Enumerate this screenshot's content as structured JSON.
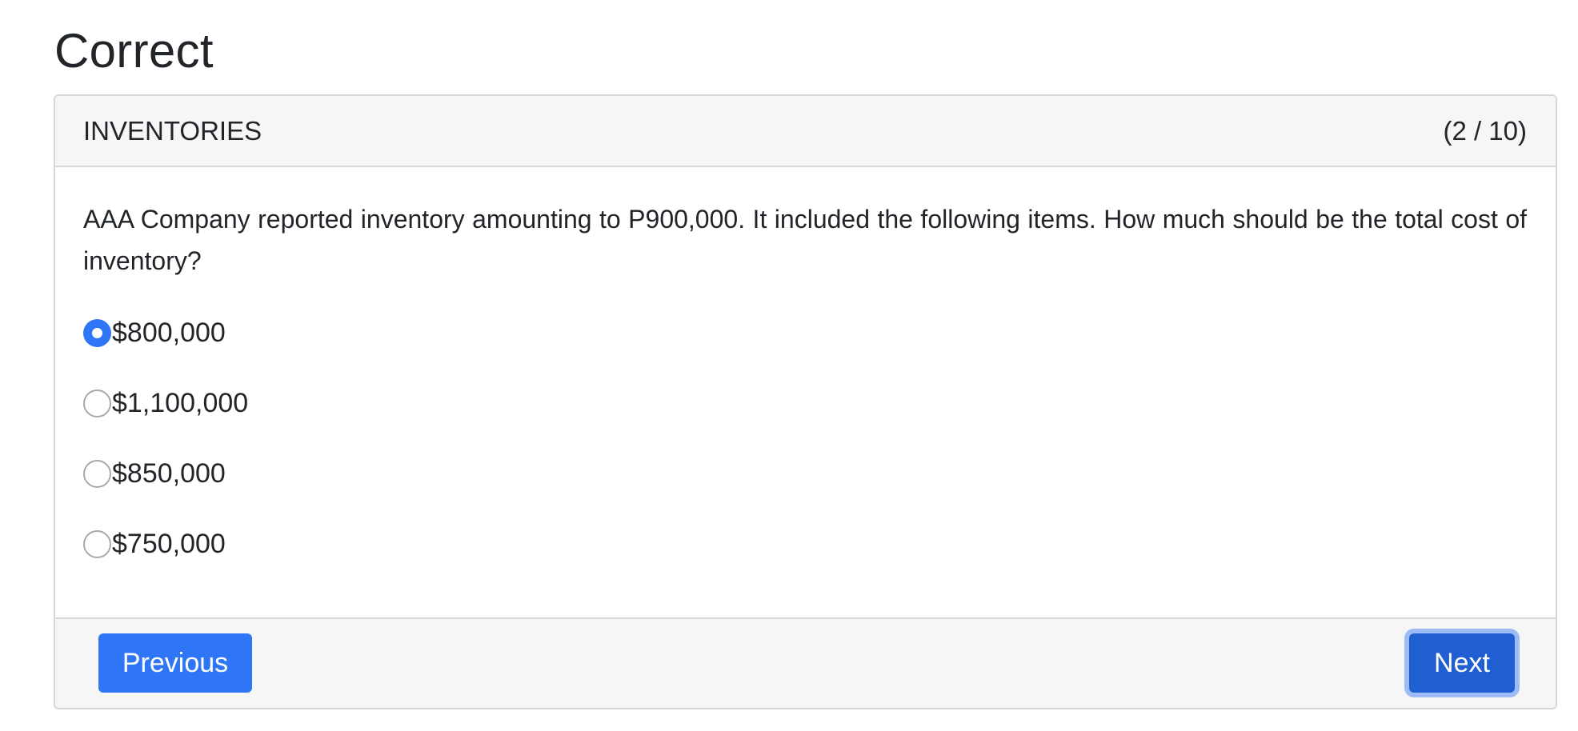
{
  "result": {
    "title": "Correct"
  },
  "quiz": {
    "category": "INVENTORIES",
    "progress": "(2 / 10)",
    "question": "AAA Company reported inventory amounting to P900,000. It included the following items. How much should be the total cost of inventory?",
    "options": [
      {
        "label": "$800,000",
        "selected": true
      },
      {
        "label": "$1,100,000",
        "selected": false
      },
      {
        "label": "$850,000",
        "selected": false
      },
      {
        "label": "$750,000",
        "selected": false
      }
    ]
  },
  "footer": {
    "previous_label": "Previous",
    "next_label": "Next"
  },
  "colors": {
    "primary": "#2f76f6",
    "primary_active": "#1f5fd1",
    "focus_ring": "#9dbcf5",
    "card_header_bg": "#f6f6f6",
    "border": "#d7d7d7",
    "text": "#212529"
  }
}
